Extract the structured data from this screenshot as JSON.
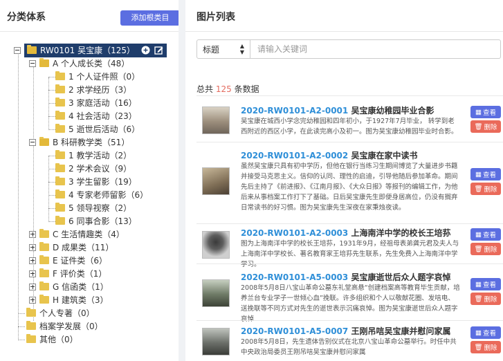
{
  "left": {
    "title": "分类体系",
    "add_root_label": "添加根类目"
  },
  "tree": {
    "root": {
      "label": "RW0101 吴宝康（125）"
    },
    "nodes": [
      {
        "label": "A 个人成长类（48）"
      },
      {
        "label": "1 个人证件照（0）"
      },
      {
        "label": "2 求学经历（3）"
      },
      {
        "label": "3 家庭活动（16）"
      },
      {
        "label": "4 社会活动（23）"
      },
      {
        "label": "5 逝世后活动（6）"
      },
      {
        "label": "B 科研教学类（51）"
      },
      {
        "label": "1 教学活动（2）"
      },
      {
        "label": "2 学术会议（9）"
      },
      {
        "label": "3 学生留影（19）"
      },
      {
        "label": "4 专家老师留影（6）"
      },
      {
        "label": "5 领导视察（2）"
      },
      {
        "label": "6 同事合影（13）"
      },
      {
        "label": "C 生活情趣类（4）"
      },
      {
        "label": "D 成果类（11）"
      },
      {
        "label": "E 证件类（6）"
      },
      {
        "label": "F 评价类（1）"
      },
      {
        "label": "G 信函类（1）"
      },
      {
        "label": "H 建筑类（3）"
      },
      {
        "label": "个人专著（0）"
      },
      {
        "label": "档案学发展（0）"
      },
      {
        "label": "其他（0）"
      }
    ]
  },
  "right": {
    "title": "图片列表",
    "search": {
      "field_label": "标题",
      "placeholder": "请输入关键词"
    },
    "total": {
      "prefix": "总共",
      "count": "125",
      "suffix": "条数据"
    },
    "buttons": {
      "view": "查看",
      "delete": "删除"
    },
    "items": [
      {
        "code": "2020-RW0101-A2-0001",
        "name": "吴宝康幼稚园毕业合影",
        "desc": "吴宝康在城西小学念完幼稚园和四年初小，于1927年7月毕业， 转学到老西附近的西区小学，在此读完高小及初一。图为吴宝康幼稚园毕业时合影。"
      },
      {
        "code": "2020-RW0101-A2-0002",
        "name": "吴宝康在家中读书",
        "desc": "虽然吴宝康只具有初中学历，但他在银行当练习生期间博览了大量进步书籍并接受马克思主义。信仰的认同、理性的启迪，引导他随后参加革命。期间先后主持了《前进报》、《江南月报》、《大众日报》等报刊的编辑工作，为他后来从事档案工作打下了基础。日后吴宝康先生即便身居高位，仍没有搁弃日常读书的好习惯。图为吴宝康先生深夜在家秉烛夜读。"
      },
      {
        "code": "2020-RW0101-A2-0003",
        "name": "上海南洋中学的校长王培荪",
        "desc": "图为上海南洋中学的校长王培荪，1931年9月，经祖母表弟龚元君及夫人与上海南洋中学校长、著名教育家王培荪先生联系，先生免费入上海南洋中学学习。"
      },
      {
        "code": "2020-RW0101-A5-0003",
        "name": "吴宝康逝世后众人题字哀悼",
        "desc": "2008年5月8日八宝山革命公墓东礼堂高悬“创建档案高等教育毕生贡献，培养兰台专业学子一世倾心血”挽联。许多组织和个人以敬献花圈、发唁电、送挽联等不同方式对先生的逝世表示沉痛哀悼。图为吴宝康逝世后众人题字哀悼"
      },
      {
        "code": "2020-RW0101-A5-0007",
        "name": "王刚吊唁吴宝康并慰问家属",
        "desc": "2008年5月8日，先生遗体告别仪式在北京八宝山革命公墓举行。时任中共中央政治局委员王刚吊唁吴宝康并慰问家属"
      }
    ]
  }
}
